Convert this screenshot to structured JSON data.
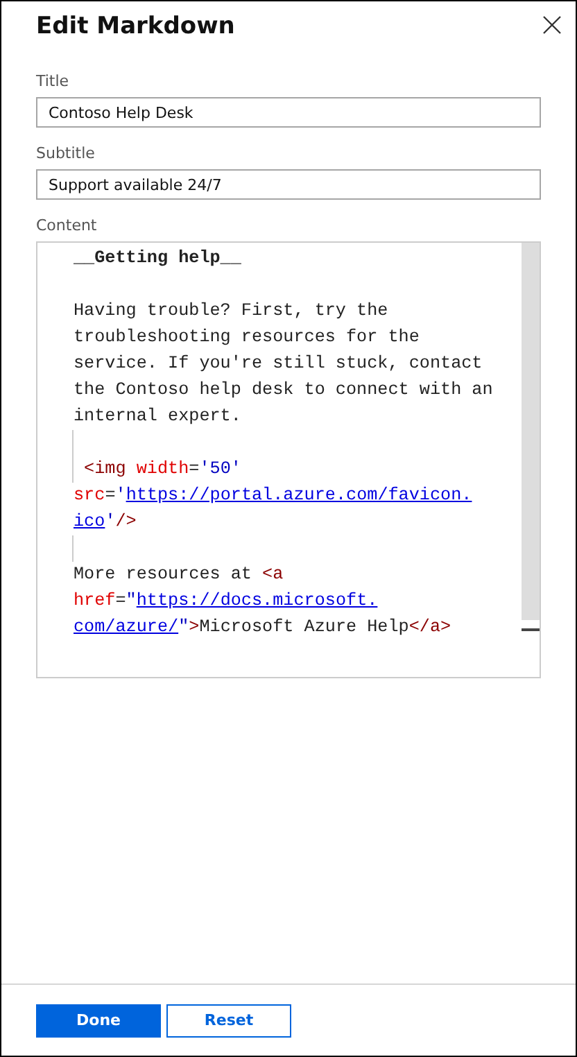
{
  "panel": {
    "title": "Edit Markdown"
  },
  "fields": [
    {
      "label": "Title",
      "value": "Contoso Help Desk"
    },
    {
      "label": "Subtitle",
      "value": "Support available 24/7"
    }
  ],
  "content": {
    "label": "Content",
    "lines": [
      {
        "indent_guide": false,
        "tokens": [
          {
            "kind": "bold",
            "text": "__Getting help__"
          }
        ]
      },
      {
        "indent_guide": false
      },
      {
        "indent_guide": false,
        "tokens": [
          {
            "kind": "text",
            "text": "Having trouble? First, try the"
          }
        ]
      },
      {
        "indent_guide": false,
        "tokens": [
          {
            "kind": "text",
            "text": "troubleshooting resources for the"
          }
        ]
      },
      {
        "indent_guide": false,
        "tokens": [
          {
            "kind": "text",
            "text": "service. If you're still stuck, contact"
          }
        ]
      },
      {
        "indent_guide": false,
        "tokens": [
          {
            "kind": "text",
            "text": "the Contoso help desk to connect with an"
          }
        ]
      },
      {
        "indent_guide": false,
        "tokens": [
          {
            "kind": "text",
            "text": "internal expert."
          }
        ]
      },
      {
        "indent_guide": true
      },
      {
        "indent_guide": true,
        "tokens": [
          {
            "kind": "tag",
            "text": " <img"
          },
          {
            "kind": "attr",
            "text": " width"
          },
          {
            "kind": "text",
            "text": "="
          },
          {
            "kind": "string",
            "text": "'50'"
          }
        ]
      },
      {
        "indent_guide": false,
        "tokens": [
          {
            "kind": "attr",
            "text": "src"
          },
          {
            "kind": "text",
            "text": "="
          },
          {
            "kind": "string",
            "text": "'"
          },
          {
            "kind": "link",
            "text": "https://portal.azure.com/favicon."
          }
        ]
      },
      {
        "indent_guide": false,
        "tokens": [
          {
            "kind": "link",
            "text": "ico"
          },
          {
            "kind": "string",
            "text": "'"
          },
          {
            "kind": "tag",
            "text": "/>"
          }
        ]
      },
      {
        "indent_guide": true
      },
      {
        "indent_guide": false,
        "tokens": [
          {
            "kind": "text",
            "text": "More resources at "
          },
          {
            "kind": "tag",
            "text": "<a"
          }
        ]
      },
      {
        "indent_guide": false,
        "tokens": [
          {
            "kind": "attr",
            "text": "href"
          },
          {
            "kind": "text",
            "text": "="
          },
          {
            "kind": "string",
            "text": "\""
          },
          {
            "kind": "link",
            "text": "https://docs.microsoft."
          }
        ]
      },
      {
        "indent_guide": false,
        "tokens": [
          {
            "kind": "link",
            "text": "com/azure/"
          },
          {
            "kind": "string",
            "text": "\""
          },
          {
            "kind": "tag",
            "text": ">"
          },
          {
            "kind": "text",
            "text": "Microsoft Azure Help"
          },
          {
            "kind": "tag",
            "text": "</a>"
          }
        ]
      }
    ]
  },
  "buttons": [
    {
      "label": "Done",
      "kind": "primary"
    },
    {
      "label": "Reset",
      "kind": "secondary"
    }
  ]
}
